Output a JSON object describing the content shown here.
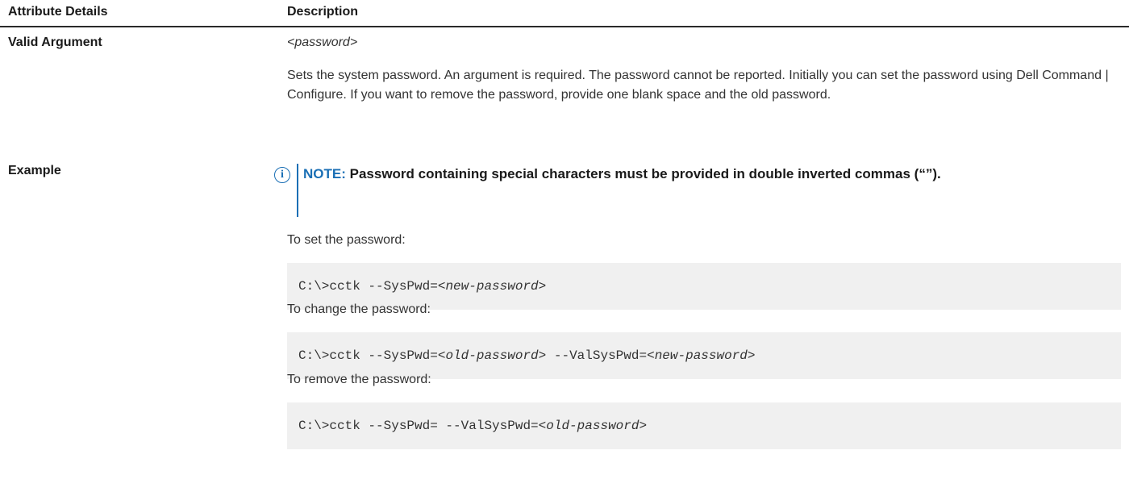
{
  "header": {
    "col1": "Attribute Details",
    "col2": "Description"
  },
  "rows": {
    "valid_argument": {
      "label": "Valid Argument",
      "value": "<password>",
      "description": "Sets the system password. An argument is required. The password cannot be reported. Initially you can set the password using Dell Command | Configure. If you want to remove the password, provide one blank space and the old password."
    },
    "example": {
      "label": "Example",
      "note": {
        "icon": "info-icon",
        "label": "NOTE:",
        "text": "Password containing special characters must be provided in double inverted commas (“”)."
      },
      "steps": [
        {
          "text": "To set the password:",
          "code": [
            {
              "t": "C:\\>cctk --SysPwd=<",
              "italic": false
            },
            {
              "t": "new-password",
              "italic": true
            },
            {
              "t": ">",
              "italic": false
            }
          ]
        },
        {
          "text": "To change the password:",
          "code": [
            {
              "t": "C:\\>cctk --SysPwd=<",
              "italic": false
            },
            {
              "t": "old-password",
              "italic": true
            },
            {
              "t": "> --ValSysPwd=<",
              "italic": false
            },
            {
              "t": "new-password",
              "italic": true
            },
            {
              "t": ">",
              "italic": false
            }
          ]
        },
        {
          "text": "To remove the password:",
          "code": [
            {
              "t": "C:\\>cctk --SysPwd= --ValSysPwd=<",
              "italic": false
            },
            {
              "t": "old-password",
              "italic": true
            },
            {
              "t": ">",
              "italic": false
            }
          ]
        }
      ]
    }
  },
  "colors": {
    "accent": "#1a6fb5",
    "code_bg": "#f0f0f0",
    "text": "#333333"
  }
}
